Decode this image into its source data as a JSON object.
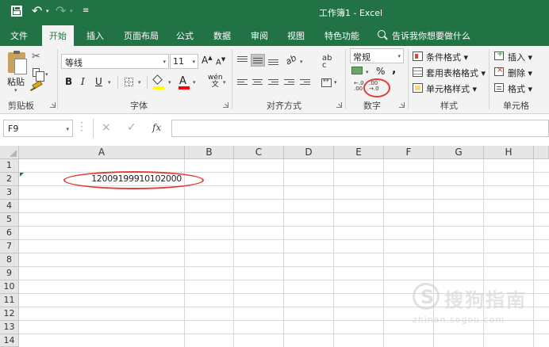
{
  "window": {
    "title": "工作簿1  -  Excel"
  },
  "quick_access": {
    "save_icon": "save-icon",
    "undo_icon": "undo-icon",
    "redo_icon": "redo-icon",
    "customize": "≡"
  },
  "tabs": [
    {
      "label": "文件"
    },
    {
      "label": "开始"
    },
    {
      "label": "插入"
    },
    {
      "label": "页面布局"
    },
    {
      "label": "公式"
    },
    {
      "label": "数据"
    },
    {
      "label": "审阅"
    },
    {
      "label": "视图"
    },
    {
      "label": "特色功能"
    }
  ],
  "active_tab": "开始",
  "tell_me": {
    "placeholder": "告诉我你想要做什么"
  },
  "ribbon": {
    "clipboard": {
      "paste_label": "粘贴",
      "group_label": "剪贴板"
    },
    "font": {
      "name": "等线",
      "size": "11",
      "bold": "B",
      "italic": "I",
      "underline": "U",
      "grow": "A",
      "shrink": "A",
      "font_color_letter": "A",
      "phonetic_top": "wén",
      "phonetic_bottom": "文",
      "group_label": "字体"
    },
    "alignment": {
      "wrap_top": "ab",
      "wrap_bottom": "c",
      "group_label": "对齐方式"
    },
    "number": {
      "format": "常规",
      "percent": "%",
      "comma": ",",
      "increase_top": ".00",
      "increase_bottom": "→.0",
      "decrease_top": "←.0",
      "decrease_bottom": ".00",
      "group_label": "数字"
    },
    "styles": {
      "conditional": "条件格式",
      "table": "套用表格格式",
      "cell": "单元格样式",
      "group_label": "样式"
    },
    "cells": {
      "insert": "插入",
      "delete": "删除",
      "format": "格式",
      "group_label": "单元格"
    }
  },
  "formula_bar": {
    "name_box": "F9",
    "cancel": "×",
    "enter": "✓",
    "fx": "fx",
    "content": ""
  },
  "sheet": {
    "columns": [
      "A",
      "B",
      "C",
      "D",
      "E",
      "F",
      "G",
      "H"
    ],
    "rows": [
      "1",
      "2",
      "3",
      "4",
      "5",
      "6",
      "7",
      "8",
      "9",
      "10",
      "11",
      "12",
      "13",
      "14"
    ],
    "cells": {
      "A2": "12009199910102000"
    }
  },
  "annotations": {
    "color": "#e23b3b",
    "circled": [
      "A2",
      "increase-decimal-button"
    ]
  },
  "watermark": {
    "text": "搜狗指南",
    "url": "zhinan.sogou.com"
  },
  "colors": {
    "accent": "#217346",
    "ribbon_bg": "#f3f3f3",
    "header_bg": "#e6e6e6",
    "annotation": "#e23b3b"
  }
}
